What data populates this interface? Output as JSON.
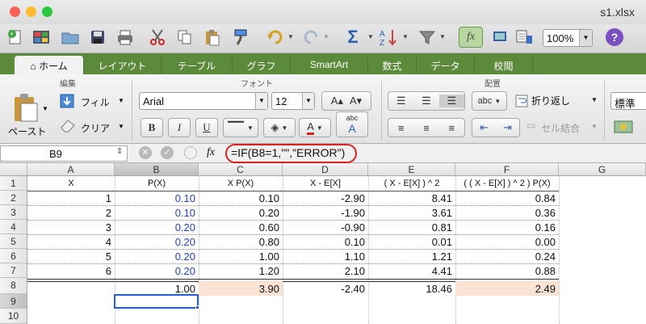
{
  "window": {
    "title": "s1.xlsx",
    "lights": {
      "close": "#fc5f57",
      "minimize": "#fdbc2e",
      "zoom": "#28c840"
    }
  },
  "toolbar": {
    "zoom": "100%",
    "icons": [
      "new-icon",
      "gallery-icon",
      "open-icon",
      "save-icon",
      "print-icon",
      "cut-icon",
      "copy-icon",
      "paste-icon",
      "format-painter-icon",
      "undo-icon",
      "redo-icon",
      "autosum-icon",
      "sort-icon",
      "filter-icon",
      "formula-builder-icon",
      "media-browser-icon",
      "help-icon"
    ],
    "autosum_glyph": "Σ",
    "formula_glyph": "fx",
    "help_glyph": "?"
  },
  "tabs": [
    "ホーム",
    "レイアウト",
    "テーブル",
    "グラフ",
    "SmartArt",
    "数式",
    "データ",
    "校閲"
  ],
  "ribbon": {
    "edit_group": "編集",
    "font_group": "フォント",
    "align_group": "配置",
    "paste": "ペースト",
    "fill": "フィル",
    "clear": "クリア",
    "font_name": "Arial",
    "font_size": "12",
    "bold": "B",
    "italic": "I",
    "underline": "U",
    "wrap": "折り返し",
    "merge": "セル結合",
    "number_format": "標準",
    "abc": "abc"
  },
  "formula_bar": {
    "name_box": "B9",
    "fx": "fx",
    "formula": "=IF(B8=1,\"\",\"ERROR\")"
  },
  "sheet": {
    "columns": [
      "A",
      "B",
      "C",
      "D",
      "E",
      "F",
      "G"
    ],
    "rows": [
      "1",
      "2",
      "3",
      "4",
      "5",
      "6",
      "7",
      "8",
      "9",
      "10"
    ],
    "header_row": [
      "X",
      "P(X)",
      "X P(X)",
      "X - E[X]",
      "( X - E[X] ) ^ 2",
      "( ( X - E[X] ) ^ 2 ) P(X)"
    ],
    "data": [
      [
        "1",
        "0.10",
        "0.10",
        "-2.90",
        "8.41",
        "0.84"
      ],
      [
        "2",
        "0.10",
        "0.20",
        "-1.90",
        "3.61",
        "0.36"
      ],
      [
        "3",
        "0.20",
        "0.60",
        "-0.90",
        "0.81",
        "0.16"
      ],
      [
        "4",
        "0.20",
        "0.80",
        "0.10",
        "0.01",
        "0.00"
      ],
      [
        "5",
        "0.20",
        "1.00",
        "1.10",
        "1.21",
        "0.24"
      ],
      [
        "6",
        "0.20",
        "1.20",
        "2.10",
        "4.41",
        "0.88"
      ]
    ],
    "totals": [
      "",
      "1.00",
      "3.90",
      "-2.40",
      "18.46",
      "2.49"
    ],
    "highlight_color": "#fbe3d3",
    "selected_cell": "B9"
  }
}
